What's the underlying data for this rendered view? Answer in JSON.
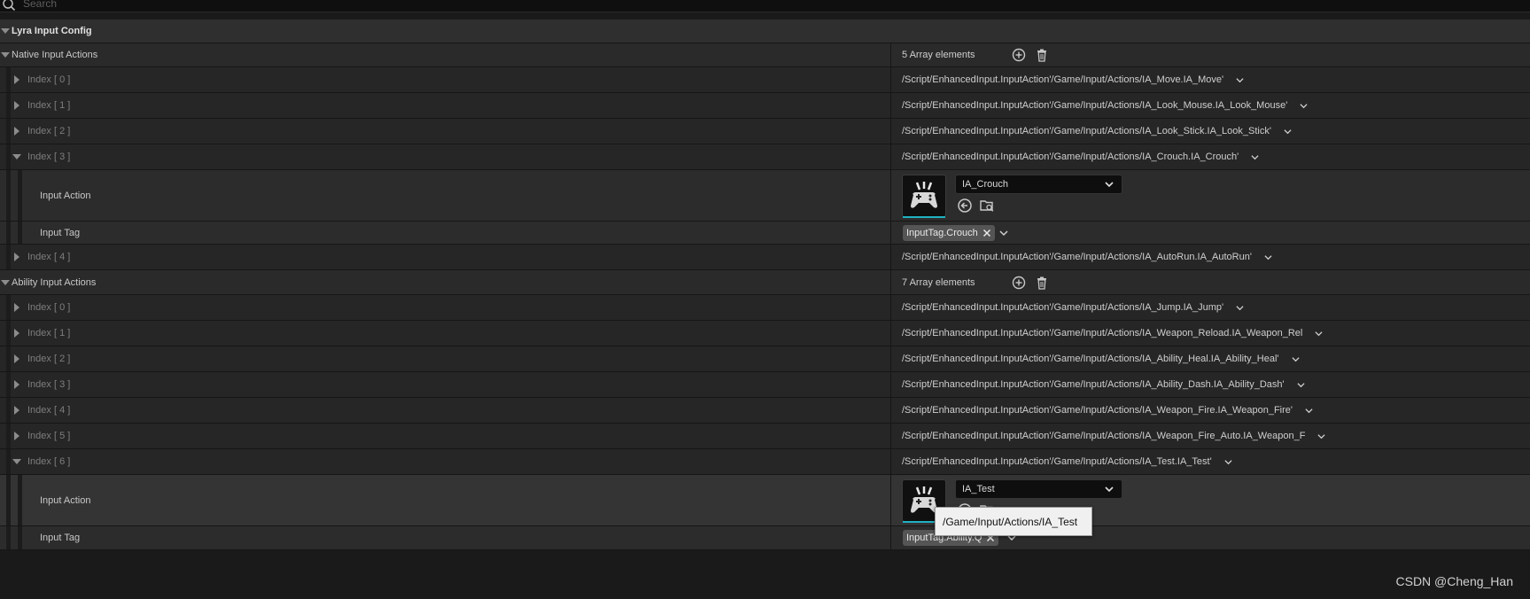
{
  "search": {
    "placeholder": "Search"
  },
  "category": {
    "title": "Lyra Input Config"
  },
  "native": {
    "label": "Native Input Actions",
    "count": "5 Array elements",
    "items": [
      {
        "index": "Index [ 0 ]",
        "path": "/Script/EnhancedInput.InputAction'/Game/Input/Actions/IA_Move.IA_Move'"
      },
      {
        "index": "Index [ 1 ]",
        "path": "/Script/EnhancedInput.InputAction'/Game/Input/Actions/IA_Look_Mouse.IA_Look_Mouse'"
      },
      {
        "index": "Index [ 2 ]",
        "path": "/Script/EnhancedInput.InputAction'/Game/Input/Actions/IA_Look_Stick.IA_Look_Stick'"
      },
      {
        "index": "Index [ 3 ]",
        "path": "/Script/EnhancedInput.InputAction'/Game/Input/Actions/IA_Crouch.IA_Crouch'"
      },
      {
        "index": "Index [ 4 ]",
        "path": "/Script/EnhancedInput.InputAction'/Game/Input/Actions/IA_AutoRun.IA_AutoRun'"
      }
    ],
    "expanded": {
      "input_action_label": "Input Action",
      "input_action_value": "IA_Crouch",
      "input_tag_label": "Input Tag",
      "input_tag_value": "InputTag.Crouch"
    }
  },
  "ability": {
    "label": "Ability Input Actions",
    "count": "7 Array elements",
    "items": [
      {
        "index": "Index [ 0 ]",
        "path": "/Script/EnhancedInput.InputAction'/Game/Input/Actions/IA_Jump.IA_Jump'"
      },
      {
        "index": "Index [ 1 ]",
        "path": "/Script/EnhancedInput.InputAction'/Game/Input/Actions/IA_Weapon_Reload.IA_Weapon_Rel"
      },
      {
        "index": "Index [ 2 ]",
        "path": "/Script/EnhancedInput.InputAction'/Game/Input/Actions/IA_Ability_Heal.IA_Ability_Heal'"
      },
      {
        "index": "Index [ 3 ]",
        "path": "/Script/EnhancedInput.InputAction'/Game/Input/Actions/IA_Ability_Dash.IA_Ability_Dash'"
      },
      {
        "index": "Index [ 4 ]",
        "path": "/Script/EnhancedInput.InputAction'/Game/Input/Actions/IA_Weapon_Fire.IA_Weapon_Fire'"
      },
      {
        "index": "Index [ 5 ]",
        "path": "/Script/EnhancedInput.InputAction'/Game/Input/Actions/IA_Weapon_Fire_Auto.IA_Weapon_F"
      },
      {
        "index": "Index [ 6 ]",
        "path": "/Script/EnhancedInput.InputAction'/Game/Input/Actions/IA_Test.IA_Test'"
      }
    ],
    "expanded": {
      "input_action_label": "Input Action",
      "input_action_value": "IA_Test",
      "input_tag_label": "Input Tag",
      "input_tag_value": "InputTag.Ability.Q"
    }
  },
  "tooltip": {
    "text": "/Game/Input/Actions/IA_Test"
  },
  "watermark": {
    "text": "CSDN @Cheng_Han"
  },
  "icons": {
    "search": "search-icon",
    "add": "plus-circle-icon",
    "delete": "trash-icon",
    "use_selected": "arrow-left-circle-icon",
    "browse": "folder-search-icon",
    "gamepad": "gamepad-icon",
    "clear": "close-icon",
    "dropdown": "chevron-down-icon"
  },
  "colors": {
    "accent": "#1fb2c4",
    "background": "#1a1a1a",
    "tag": "#555555"
  }
}
